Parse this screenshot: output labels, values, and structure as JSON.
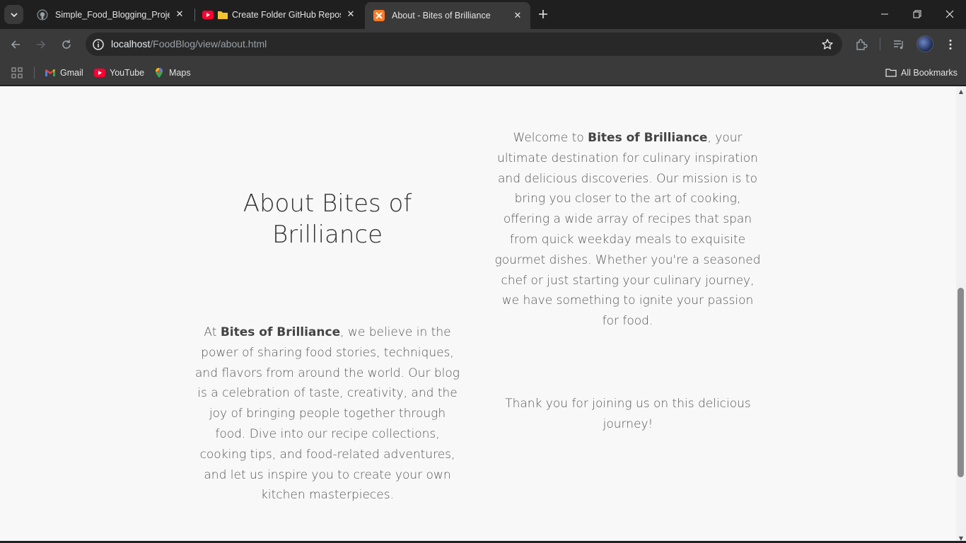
{
  "browser": {
    "tabs": [
      {
        "title": "Simple_Food_Blogging_Project/",
        "icon": "github-icon"
      },
      {
        "title": "Create Folder GitHub Repos",
        "icon": "youtube-folder-icon"
      },
      {
        "title": "About - Bites of Brilliance",
        "icon": "xampp-icon",
        "active": true
      }
    ],
    "address": {
      "host": "localhost",
      "path": "/FoodBlog/view/about.html"
    },
    "bookmarks": [
      {
        "label": "Gmail",
        "icon": "gmail-icon"
      },
      {
        "label": "YouTube",
        "icon": "youtube-icon"
      },
      {
        "label": "Maps",
        "icon": "maps-icon"
      }
    ],
    "all_bookmarks_label": "All Bookmarks",
    "colors": {
      "frame": "#1f1f1f",
      "toolbar": "#3a3a3a",
      "page_background": "#f8f8f8",
      "text": "#555555"
    }
  },
  "page": {
    "heading": "About Bites of Brilliance",
    "brand": "Bites of Brilliance",
    "intro": {
      "before": "Welcome to ",
      "after": ", your ultimate destination for culinary inspiration and delicious discoveries. Our mission is to bring you closer to the art of cooking, offering a wide array of recipes that span from quick weekday meals to exquisite gourmet dishes. Whether you're a seasoned chef or just starting your culinary journey, we have something to ignite your passion for food."
    },
    "belief": {
      "before": "At ",
      "after": ", we believe in the power of sharing food stories, techniques, and flavors from around the world. Our blog is a celebration of taste, creativity, and the joy of bringing people together through food. Dive into our recipe collections, cooking tips, and food-related adventures, and let us inspire you to create your own kitchen masterpieces."
    },
    "thanks": "Thank you for joining us on this delicious journey!"
  }
}
